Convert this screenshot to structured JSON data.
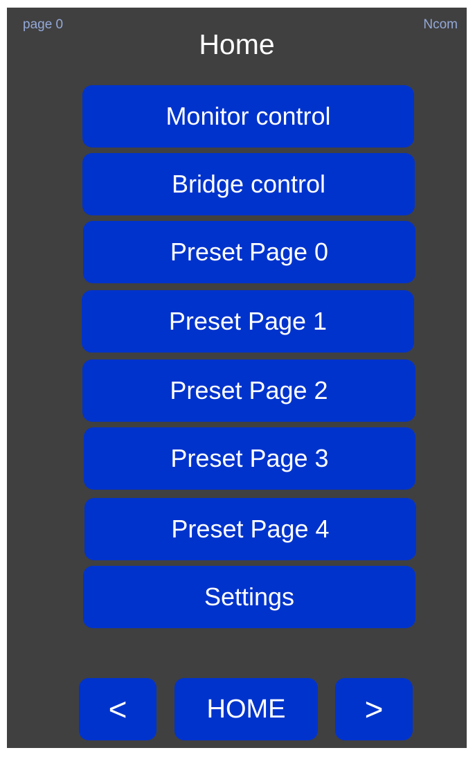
{
  "header": {
    "page_indicator": "page 0",
    "brand": "Ncom",
    "title": "Home"
  },
  "menu": {
    "items": [
      {
        "label": "Monitor control"
      },
      {
        "label": "Bridge control"
      },
      {
        "label": "Preset Page 0"
      },
      {
        "label": "Preset Page 1"
      },
      {
        "label": "Preset Page 2"
      },
      {
        "label": "Preset Page 3"
      },
      {
        "label": "Preset Page 4"
      },
      {
        "label": "Settings"
      }
    ]
  },
  "nav": {
    "prev_label": "<",
    "home_label": "HOME",
    "next_label": ">"
  },
  "colors": {
    "background": "#404040",
    "button": "#0033cc",
    "text": "#ffffff",
    "header_small_text": "#94a9d8"
  }
}
